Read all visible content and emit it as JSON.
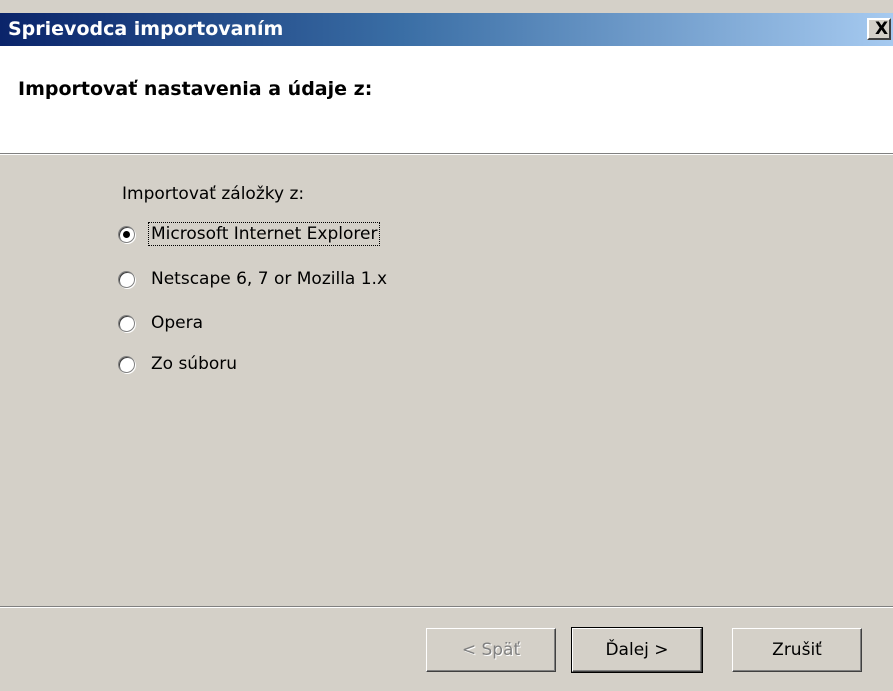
{
  "window": {
    "title": "Sprievodca importovaním",
    "close_label": "X"
  },
  "header": {
    "title": "Importovať nastavenia a údaje z:"
  },
  "import_group": {
    "label": "Importovať záložky z:",
    "options": [
      {
        "label": "Microsoft Internet Explorer",
        "selected": true
      },
      {
        "label": "Netscape 6, 7 or Mozilla 1.x",
        "selected": false
      },
      {
        "label": "Opera",
        "selected": false
      },
      {
        "label": "Zo súboru",
        "selected": false
      }
    ]
  },
  "buttons": {
    "back_label": "< Späť",
    "back_enabled": false,
    "next_label": "Ďalej >",
    "cancel_label": "Zrušiť"
  },
  "colors": {
    "title_gradient_start": "#0a246a",
    "title_gradient_end": "#a6caf0",
    "face": "#d4d0c8",
    "header_bg": "#ffffff"
  }
}
